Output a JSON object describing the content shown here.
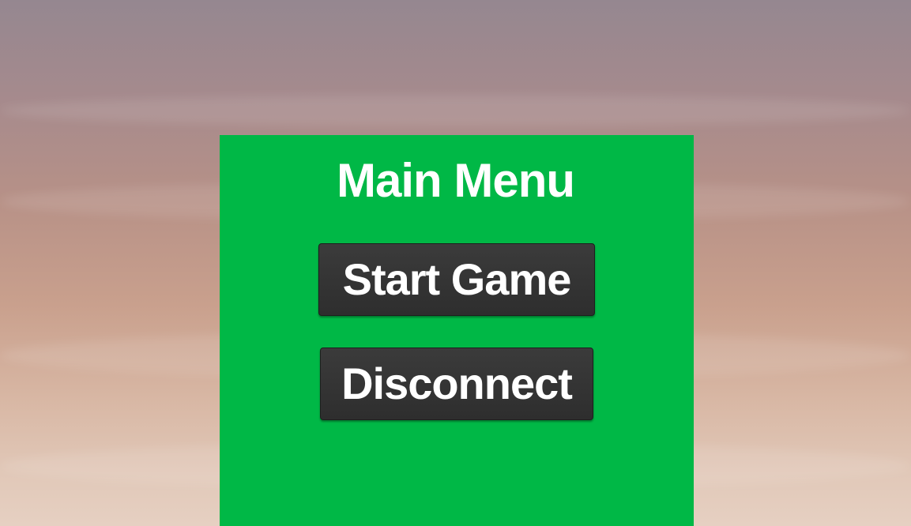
{
  "menu": {
    "title": "Main Menu",
    "start_label": "Start Game",
    "disconnect_label": "Disconnect"
  },
  "colors": {
    "panel": "#00b846",
    "button": "#333333",
    "text": "#ffffff"
  }
}
